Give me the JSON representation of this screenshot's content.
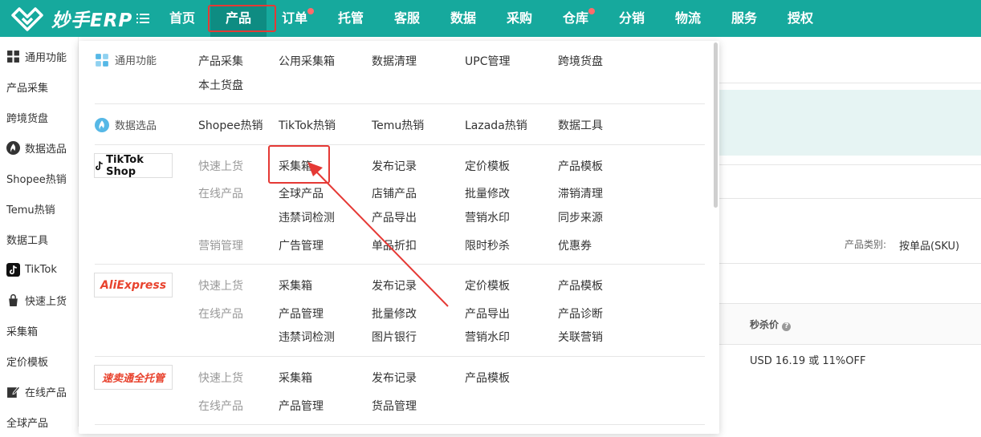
{
  "app": {
    "logo_text": "妙手ERP",
    "accent": "#16a99d",
    "highlight_color": "#e53935"
  },
  "nav": {
    "items": [
      "首页",
      "产品",
      "订单",
      "托管",
      "客服",
      "数据",
      "采购",
      "仓库",
      "分销",
      "物流",
      "服务",
      "授权"
    ]
  },
  "sidebar": {
    "items": [
      "通用功能",
      "产品采集",
      "跨境货盘",
      "数据选品",
      "Shopee热销",
      "Temu热销",
      "数据工具",
      "TikTok",
      "快速上货",
      "采集箱",
      "定价模板",
      "在线产品",
      "全球产品"
    ]
  },
  "background": {
    "product_type_label": "产品类别:",
    "product_type_value": "按单品(SKU)",
    "flash_price_header": "秒杀价",
    "flash_price_value": "USD 16.19 或 11%OFF"
  },
  "menu": {
    "general": {
      "label": "通用功能",
      "items": [
        "产品采集",
        "公用采集箱",
        "数据清理",
        "UPC管理",
        "跨境货盘",
        "本土货盘"
      ]
    },
    "data": {
      "label": "数据选品",
      "items": [
        "Shopee热销",
        "TikTok热销",
        "Temu热销",
        "Lazada热销",
        "数据工具"
      ]
    },
    "tiktok": {
      "brand": "TikTok Shop",
      "quick_label": "快速上货",
      "quick_items": [
        "采集箱",
        "发布记录",
        "定价模板",
        "产品模板"
      ],
      "online_label": "在线产品",
      "online_items": [
        "全球产品",
        "店铺产品",
        "批量修改",
        "滞销清理",
        "违禁词检测",
        "产品导出",
        "营销水印",
        "同步来源"
      ],
      "marketing_label": "营销管理",
      "marketing_items": [
        "广告管理",
        "单品折扣",
        "限时秒杀",
        "优惠券"
      ]
    },
    "aliexpress": {
      "brand": "AliExpress",
      "quick_label": "快速上货",
      "quick_items": [
        "采集箱",
        "发布记录",
        "定价模板",
        "产品模板"
      ],
      "online_label": "在线产品",
      "online_items": [
        "产品管理",
        "批量修改",
        "产品导出",
        "产品诊断",
        "违禁词检测",
        "图片银行",
        "营销水印",
        "关联营销"
      ]
    },
    "sumaitong": {
      "brand": "速卖通全托管",
      "quick_label": "快速上货",
      "quick_items": [
        "采集箱",
        "发布记录",
        "产品模板"
      ],
      "online_label": "在线产品",
      "online_items": [
        "产品管理",
        "货品管理"
      ]
    }
  }
}
